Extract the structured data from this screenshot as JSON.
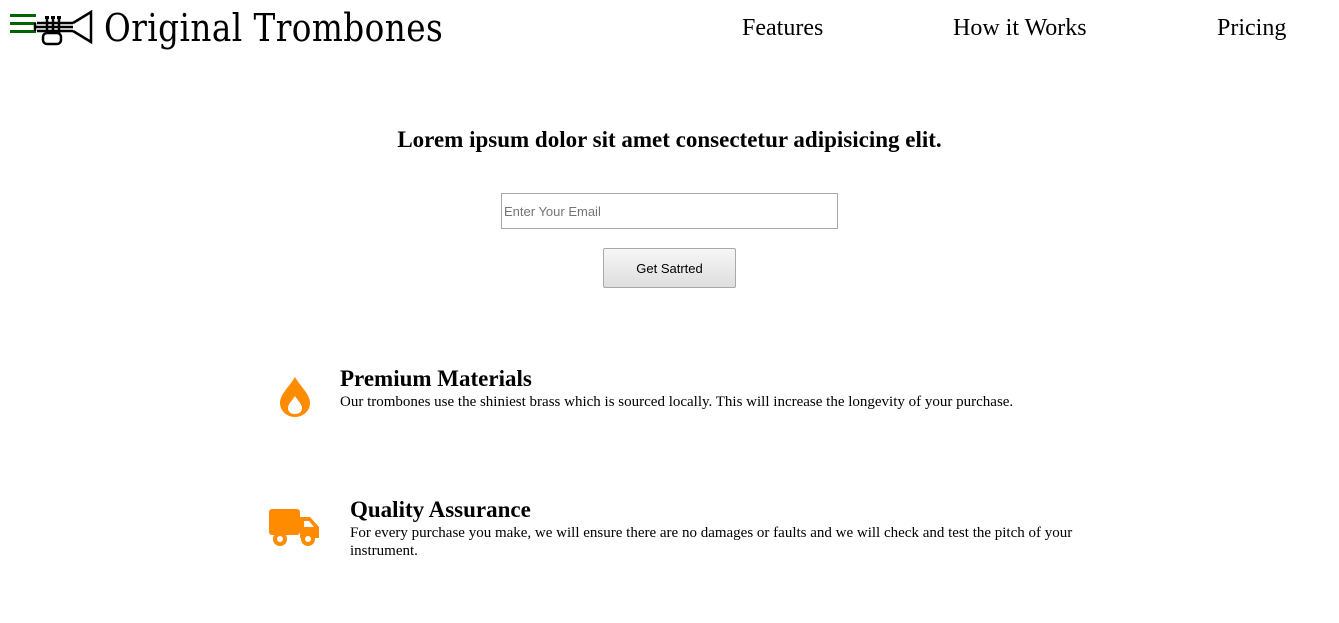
{
  "header": {
    "menu_icon": "hamburger-menu-icon",
    "logo_icon": "trumpet-icon",
    "brand": "Original Trombones",
    "nav": [
      {
        "label": "Features"
      },
      {
        "label": "How it Works"
      },
      {
        "label": "Pricing"
      }
    ]
  },
  "hero": {
    "title": "Lorem ipsum dolor sit amet consectetur adipisicing elit.",
    "email_placeholder": "Enter Your Email",
    "email_value": "",
    "button_label": "Get Satrted"
  },
  "features": [
    {
      "icon": "flame-icon",
      "title": "Premium Materials",
      "description": "Our trombones use the shiniest brass which is sourced locally. This will increase the longevity of your purchase."
    },
    {
      "icon": "truck-icon",
      "title": "Quality Assurance",
      "description": "For every purchase you make, we will ensure there are no damages or faults and we will check and test the pitch of your instrument."
    }
  ],
  "colors": {
    "menu_icon": "#006400",
    "feature_icon": "#ff8c00",
    "text": "#000000"
  }
}
